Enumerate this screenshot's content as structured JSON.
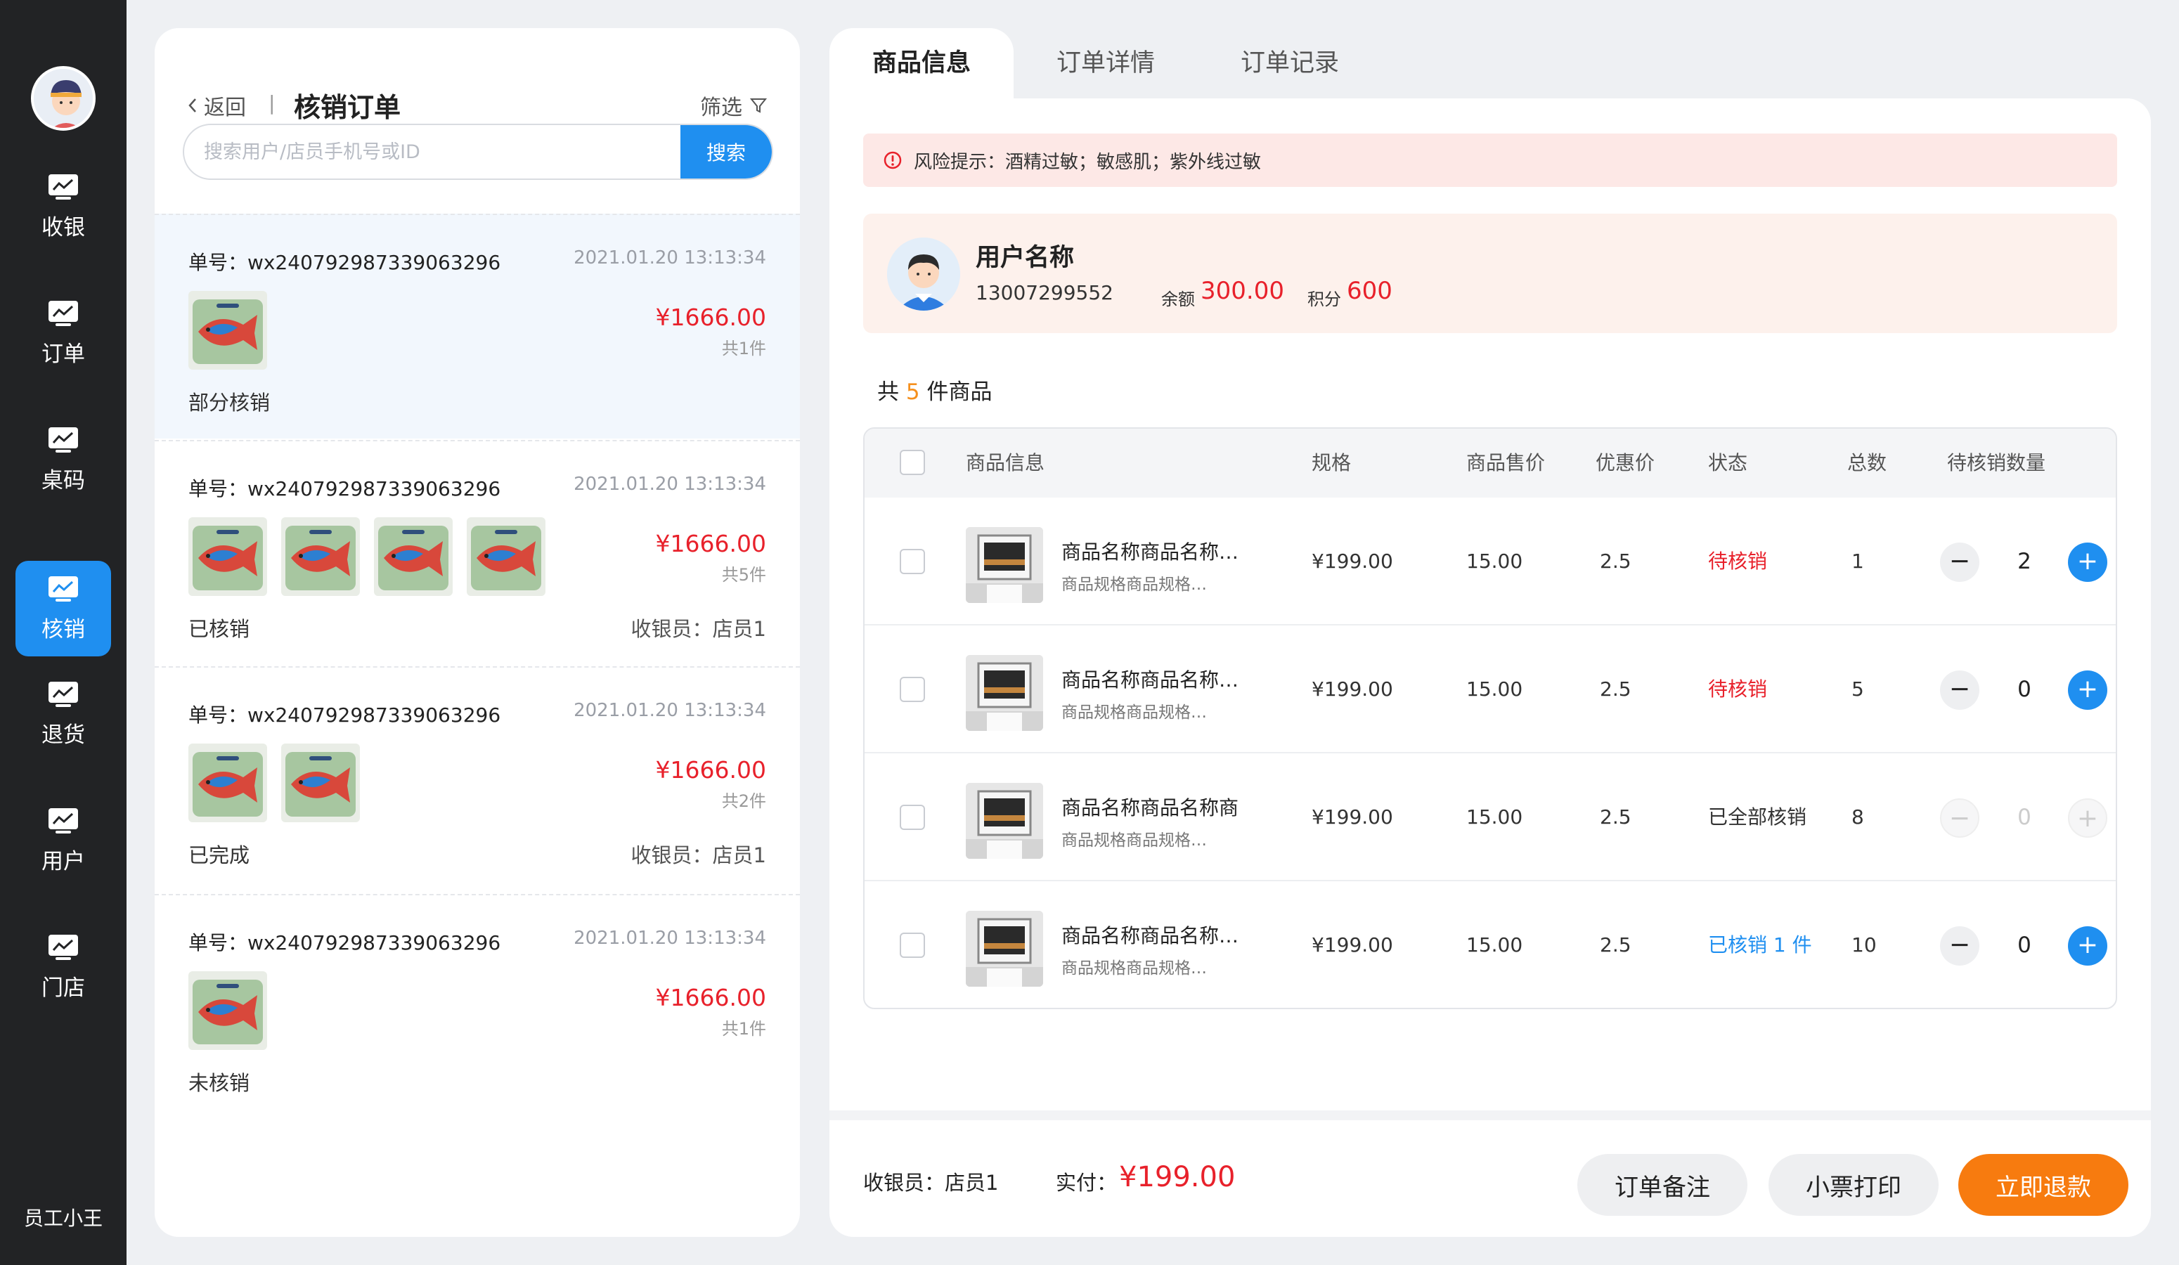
{
  "sidebar": {
    "items": [
      {
        "label": "收银",
        "icon": "chart-icon"
      },
      {
        "label": "订单",
        "icon": "chart-icon"
      },
      {
        "label": "桌码",
        "icon": "chart-icon"
      },
      {
        "label": "核销",
        "icon": "chart-icon",
        "active": true
      },
      {
        "label": "退货",
        "icon": "chart-icon"
      },
      {
        "label": "用户",
        "icon": "chart-icon"
      },
      {
        "label": "门店",
        "icon": "chart-icon"
      }
    ],
    "staff": "员工小王"
  },
  "order_list": {
    "back_label": "返回",
    "separator": "|",
    "title": "核销订单",
    "filter_label": "筛选",
    "search_placeholder": "搜索用户/店员手机号或ID",
    "search_button": "搜索",
    "orders": [
      {
        "no": "单号：wx240792987339063296",
        "time": "2021.01.20 13:13:34",
        "price": "¥1666.00",
        "count": "共1件",
        "status": "部分核销",
        "cashier": ""
      },
      {
        "no": "单号：wx240792987339063296",
        "time": "2021.01.20 13:13:34",
        "price": "¥1666.00",
        "count": "共5件",
        "status": "已核销",
        "cashier": "收银员：店员1"
      },
      {
        "no": "单号：wx240792987339063296",
        "time": "2021.01.20 13:13:34",
        "price": "¥1666.00",
        "count": "共2件",
        "status": "已完成",
        "cashier": "收银员：店员1"
      },
      {
        "no": "单号：wx240792987339063296",
        "time": "2021.01.20 13:13:34",
        "price": "¥1666.00",
        "count": "共1件",
        "status": "未核销",
        "cashier": ""
      }
    ]
  },
  "detail": {
    "tabs": [
      "商品信息",
      "订单详情",
      "订单记录"
    ],
    "risk_text": "风险提示：酒精过敏；敏感肌；紫外线过敏",
    "user": {
      "name": "用户名称",
      "phone": "13007299552",
      "balance_label": "余额",
      "balance": "300.00",
      "points_label": "积分",
      "points": "600"
    },
    "goods_count": {
      "prefix": "共",
      "num": "5",
      "suffix": "件商品"
    },
    "table": {
      "headers": [
        "商品信息",
        "规格",
        "商品售价",
        "优惠价",
        "状态",
        "总数",
        "待核销数量"
      ],
      "rows": [
        {
          "name": "商品名称商品名称…",
          "spec_sub": "商品规格商品规格…",
          "spec": "¥199.00",
          "price": "15.00",
          "discount": "2.5",
          "status": "待核销",
          "status_type": "pending",
          "total": "1",
          "qty": "2",
          "enabled": true
        },
        {
          "name": "商品名称商品名称…",
          "spec_sub": "商品规格商品规格…",
          "spec": "¥199.00",
          "price": "15.00",
          "discount": "2.5",
          "status": "待核销",
          "status_type": "pending",
          "total": "5",
          "qty": "0",
          "enabled": true
        },
        {
          "name": "商品名称商品名称商",
          "spec_sub": "商品规格商品规格…",
          "spec": "¥199.00",
          "price": "15.00",
          "discount": "2.5",
          "status": "已全部核销",
          "status_type": "done",
          "total": "8",
          "qty": "0",
          "enabled": false
        },
        {
          "name": "商品名称商品名称…",
          "spec_sub": "商品规格商品规格…",
          "spec": "¥199.00",
          "price": "15.00",
          "discount": "2.5",
          "status": "已核销 1 件",
          "status_type": "partial",
          "total": "10",
          "qty": "0",
          "enabled": true
        }
      ]
    },
    "footer": {
      "cashier": "收银员：店员1",
      "paid_label": "实付：",
      "paid": "¥199.00",
      "buttons": [
        "订单备注",
        "小票打印",
        "立即退款"
      ]
    }
  },
  "colors": {
    "accent": "#1f8ff0",
    "price_red": "#e8212b",
    "refund_orange": "#f77b0f",
    "sidebar_bg": "#222325"
  }
}
